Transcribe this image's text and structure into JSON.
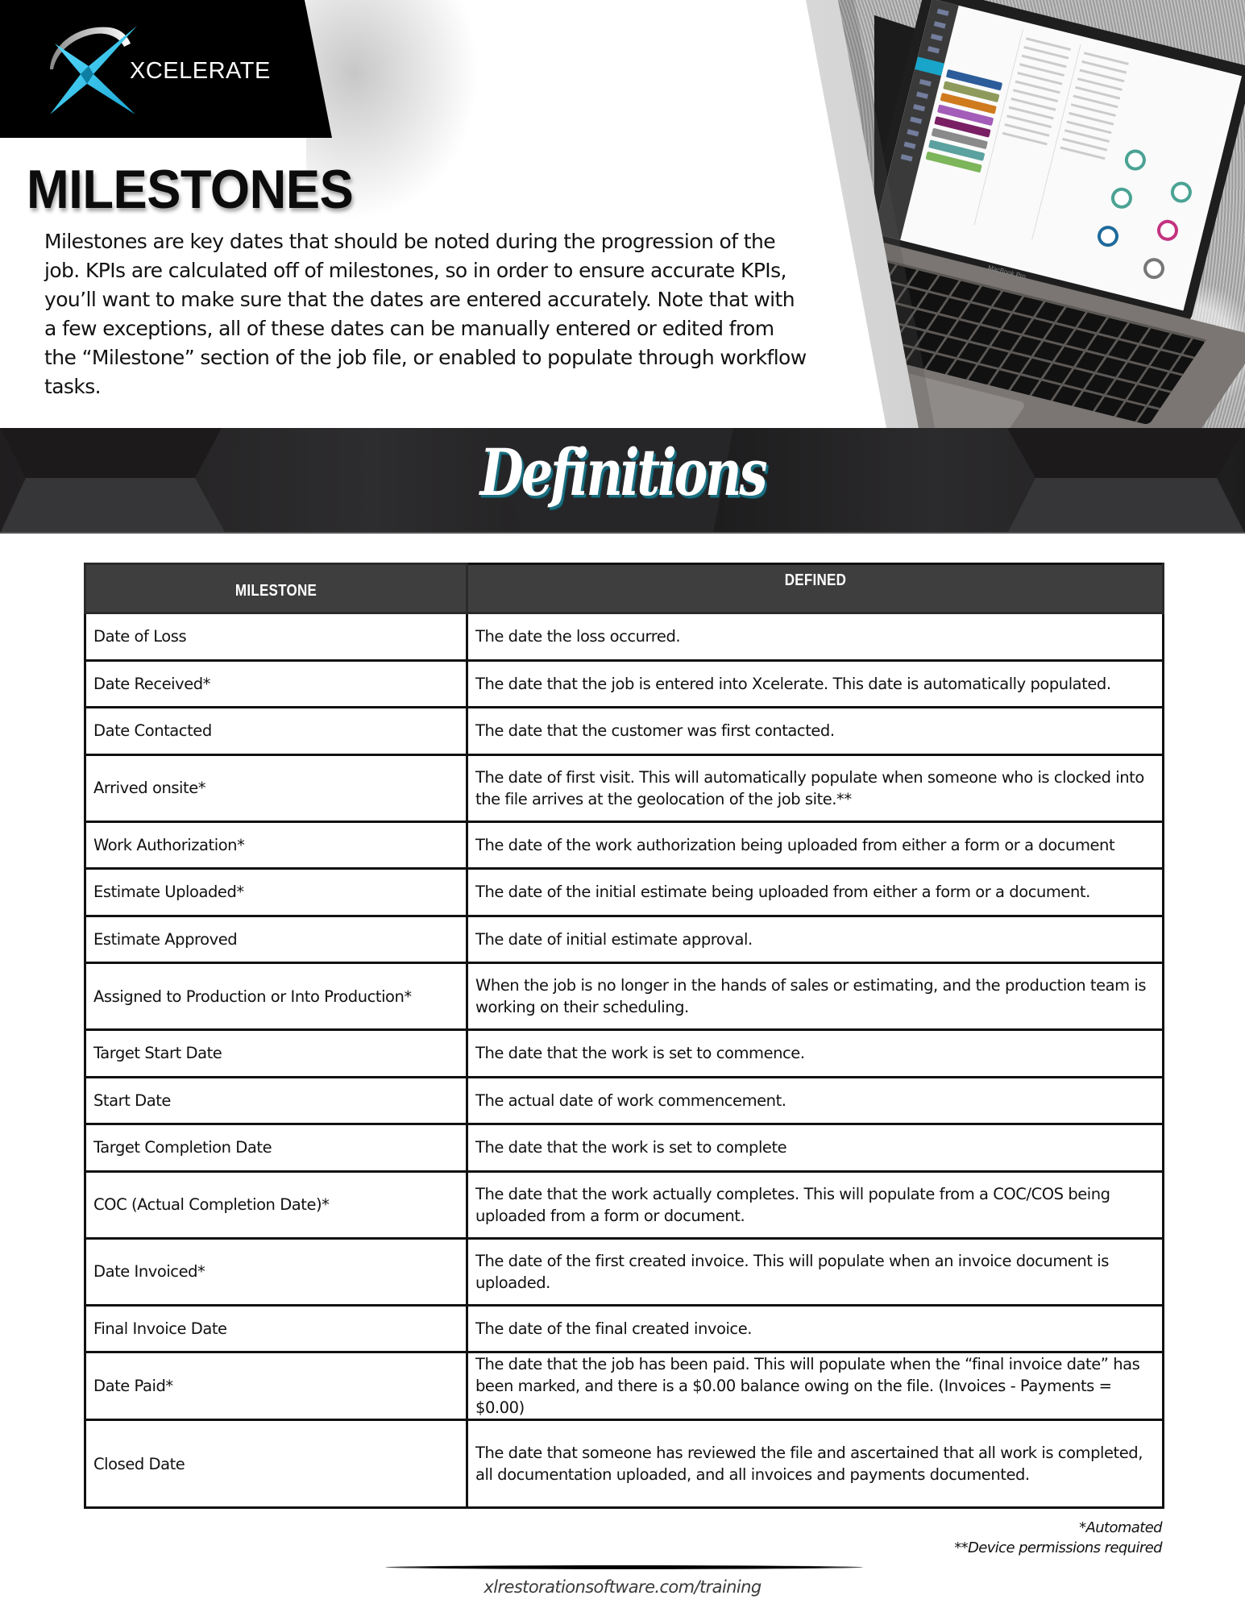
{
  "brand": {
    "logo_text": "XCELERATE",
    "logo_icon": "xcelerate-x-swoosh-icon",
    "accent_color": "#29c3e8"
  },
  "hero": {
    "title": "MILESTONES",
    "intro": "Milestones are key dates that should be noted during the progression of the job. KPIs are calculated off of milestones, so in order to ensure accurate KPIs, you’ll want to make sure that the dates are entered accurately. Note that with a few exceptions, all of these dates can be manually entered or edited from the “Milestone” section of the job file, or enabled to populate through workflow tasks.",
    "photo": "laptop-showing-xcelerate-job-file",
    "laptop_label": "MacBook Pro"
  },
  "banner": {
    "title": "Definitions"
  },
  "table": {
    "headers": [
      "MILESTONE",
      "DEFINED"
    ],
    "rows": [
      {
        "milestone": "Date of Loss",
        "defined": "The date the loss occurred."
      },
      {
        "milestone": "Date Received*",
        "defined": "The date that the job is entered into Xcelerate. This date is automatically populated."
      },
      {
        "milestone": "Date Contacted",
        "defined": "The date that the customer was first contacted."
      },
      {
        "milestone": "Arrived onsite*",
        "defined": "The date of first visit. This will automatically populate when someone who is clocked into the file arrives at the geolocation of the job site.**"
      },
      {
        "milestone": "Work Authorization*",
        "defined": "The date of the work authorization being uploaded from either a form or a document"
      },
      {
        "milestone": "Estimate Uploaded*",
        "defined": "The date of the initial estimate being uploaded from either a form or a document."
      },
      {
        "milestone": "Estimate Approved",
        "defined": "The date of initial estimate approval."
      },
      {
        "milestone": "Assigned to Production or Into Production*",
        "defined": "When the job is no longer in the hands of sales or estimating, and the production team is working on their scheduling."
      },
      {
        "milestone": "Target Start Date",
        "defined": "The date that the work is set to commence."
      },
      {
        "milestone": "Start Date",
        "defined": "The actual date of work commencement."
      },
      {
        "milestone": "Target Completion Date",
        "defined": "The date that the work is set to complete"
      },
      {
        "milestone": "COC (Actual Completion Date)*",
        "defined": "The date that the work actually completes. This will populate from a COC/COS being uploaded from a form or document."
      },
      {
        "milestone": "Date Invoiced*",
        "defined": "The date of the first created invoice. This will populate when an invoice document is uploaded."
      },
      {
        "milestone": "Final Invoice Date",
        "defined": "The date of the final created invoice."
      },
      {
        "milestone": "Date Paid*",
        "defined": "The date that the job has been paid. This will populate when the “final invoice date” has been marked, and there is a $0.00 balance owing on the file. (Invoices - Payments = $0.00)"
      },
      {
        "milestone": "Closed Date",
        "defined": "The date that someone has reviewed the file and ascertained that all work is completed, all documentation uploaded, and all invoices and payments documented."
      }
    ]
  },
  "footnotes": {
    "automated": "*Automated",
    "device": "**Device permissions required"
  },
  "footer": {
    "url": "xlrestorationsoftware.com/training"
  }
}
